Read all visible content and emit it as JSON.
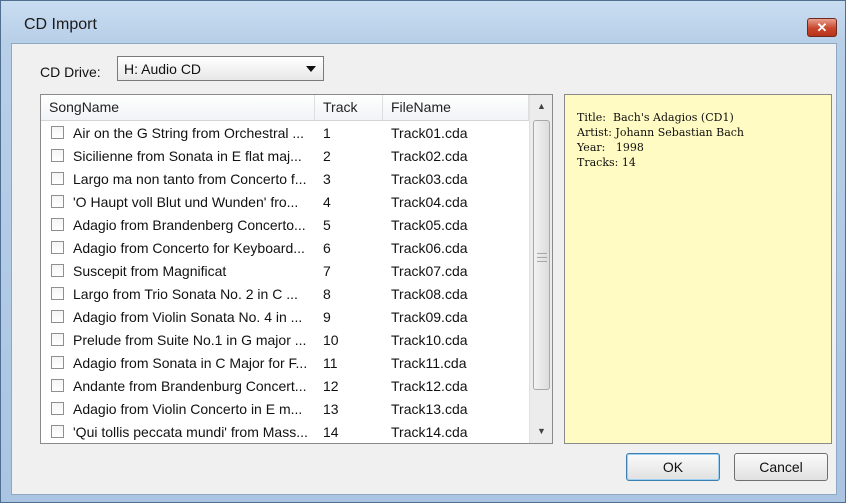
{
  "window": {
    "title": "CD Import",
    "close_glyph": "✕"
  },
  "drive": {
    "label": "CD Drive:",
    "selected": "H: Audio CD"
  },
  "columns": {
    "song": "SongName",
    "track": "Track",
    "file": "FileName"
  },
  "tracks": [
    {
      "song": "Air on the G String from Orchestral ...",
      "track": "1",
      "file": "Track01.cda"
    },
    {
      "song": "Sicilienne from Sonata in E flat maj...",
      "track": "2",
      "file": "Track02.cda"
    },
    {
      "song": "Largo ma non tanto from Concerto f...",
      "track": "3",
      "file": "Track03.cda"
    },
    {
      "song": "'O Haupt voll Blut und Wunden' fro...",
      "track": "4",
      "file": "Track04.cda"
    },
    {
      "song": "Adagio from Brandenberg Concerto...",
      "track": "5",
      "file": "Track05.cda"
    },
    {
      "song": "Adagio from Concerto for Keyboard...",
      "track": "6",
      "file": "Track06.cda"
    },
    {
      "song": "Suscepit from Magnificat",
      "track": "7",
      "file": "Track07.cda"
    },
    {
      "song": "Largo from Trio Sonata No. 2 in C ...",
      "track": "8",
      "file": "Track08.cda"
    },
    {
      "song": "Adagio from Violin Sonata No. 4 in ...",
      "track": "9",
      "file": "Track09.cda"
    },
    {
      "song": "Prelude from Suite No.1 in G major ...",
      "track": "10",
      "file": "Track10.cda"
    },
    {
      "song": "Adagio from Sonata in C Major for F...",
      "track": "11",
      "file": "Track11.cda"
    },
    {
      "song": "Andante from Brandenburg Concert...",
      "track": "12",
      "file": "Track12.cda"
    },
    {
      "song": "Adagio from Violin Concerto in E m...",
      "track": "13",
      "file": "Track13.cda"
    },
    {
      "song": "'Qui tollis peccata mundi' from Mass...",
      "track": "14",
      "file": "Track14.cda"
    }
  ],
  "info": {
    "title_line": "Title:  Bach's Adagios (CD1)",
    "artist_line": "Artist: Johann Sebastian Bach",
    "year_line": "Year:   1998",
    "tracks_line": "Tracks: 14"
  },
  "buttons": {
    "ok": "OK",
    "cancel": "Cancel"
  },
  "icons": {
    "close": "close-icon",
    "dropdown": "chevron-down-icon",
    "scroll_up": "scroll-up-arrow",
    "scroll_down": "scroll-down-arrow"
  },
  "colors": {
    "info_background": "#fffbc3",
    "title_bar": "#b8cfe8",
    "close_button": "#c7462c"
  }
}
